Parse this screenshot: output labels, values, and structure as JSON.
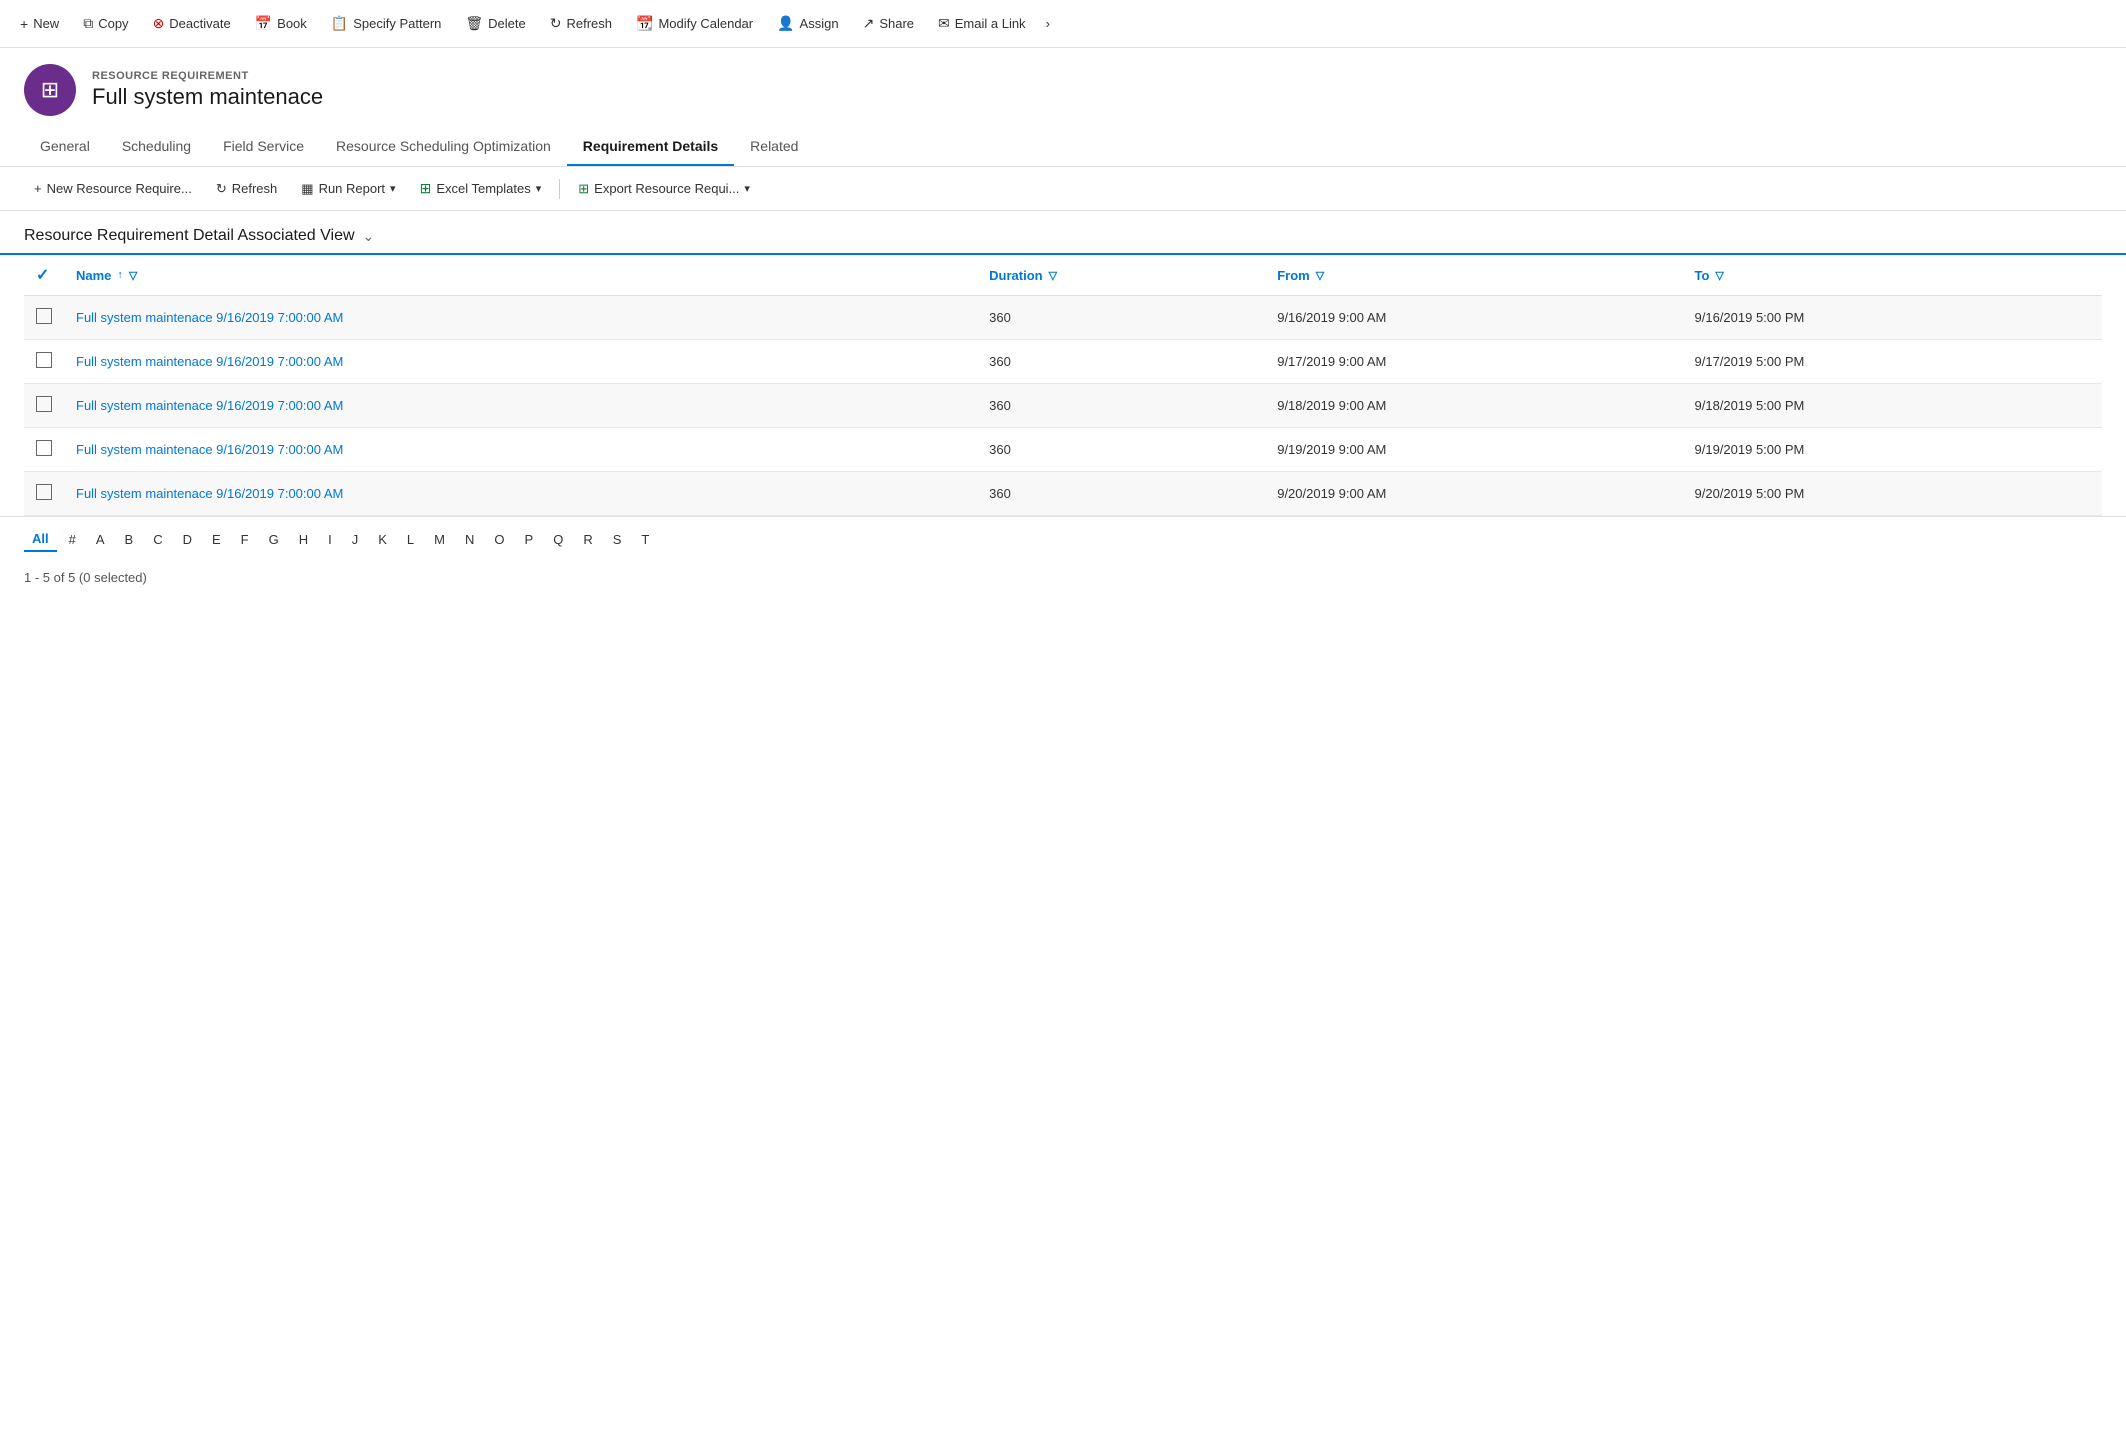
{
  "toolbar": {
    "buttons": [
      {
        "label": "New",
        "icon": "+",
        "name": "new-button"
      },
      {
        "label": "Copy",
        "icon": "⧉",
        "name": "copy-button"
      },
      {
        "label": "Deactivate",
        "icon": "⊗",
        "name": "deactivate-button"
      },
      {
        "label": "Book",
        "icon": "📅",
        "name": "book-button"
      },
      {
        "label": "Specify Pattern",
        "icon": "📋",
        "name": "specify-pattern-button"
      },
      {
        "label": "Delete",
        "icon": "🗑",
        "name": "delete-button"
      },
      {
        "label": "Refresh",
        "icon": "↻",
        "name": "refresh-button"
      },
      {
        "label": "Modify Calendar",
        "icon": "📆",
        "name": "modify-calendar-button"
      },
      {
        "label": "Assign",
        "icon": "👤",
        "name": "assign-button"
      },
      {
        "label": "Share",
        "icon": "↗",
        "name": "share-button"
      },
      {
        "label": "Email a Link",
        "icon": "✉",
        "name": "email-link-button"
      }
    ]
  },
  "record": {
    "type": "RESOURCE REQUIREMENT",
    "title": "Full system maintenace",
    "icon": "⊞"
  },
  "tabs": [
    {
      "label": "General",
      "active": false
    },
    {
      "label": "Scheduling",
      "active": false
    },
    {
      "label": "Field Service",
      "active": false
    },
    {
      "label": "Resource Scheduling Optimization",
      "active": false
    },
    {
      "label": "Requirement Details",
      "active": true
    },
    {
      "label": "Related",
      "active": false
    }
  ],
  "sub_toolbar": {
    "buttons": [
      {
        "label": "New Resource Require...",
        "icon": "+",
        "name": "new-resource-req-button"
      },
      {
        "label": "Refresh",
        "icon": "↻",
        "name": "sub-refresh-button"
      },
      {
        "label": "Run Report",
        "icon": "▦",
        "name": "run-report-button",
        "dropdown": true
      },
      {
        "label": "Excel Templates",
        "icon": "⊞",
        "name": "excel-templates-button",
        "dropdown": true
      },
      {
        "label": "Export Resource Requi...",
        "icon": "⊞",
        "name": "export-button",
        "dropdown": true
      }
    ]
  },
  "view": {
    "title": "Resource Requirement Detail Associated View"
  },
  "grid": {
    "columns": [
      {
        "label": "Name",
        "name": "name-col",
        "sortable": true,
        "filterable": true
      },
      {
        "label": "Duration",
        "name": "duration-col",
        "sortable": false,
        "filterable": true
      },
      {
        "label": "From",
        "name": "from-col",
        "sortable": false,
        "filterable": true
      },
      {
        "label": "To",
        "name": "to-col",
        "sortable": false,
        "filterable": true
      }
    ],
    "rows": [
      {
        "name": "Full system maintenace 9/16/2019 7:00:00 AM",
        "duration": "360",
        "from": "9/16/2019 9:00 AM",
        "to": "9/16/2019 5:00 PM"
      },
      {
        "name": "Full system maintenace 9/16/2019 7:00:00 AM",
        "duration": "360",
        "from": "9/17/2019 9:00 AM",
        "to": "9/17/2019 5:00 PM"
      },
      {
        "name": "Full system maintenace 9/16/2019 7:00:00 AM",
        "duration": "360",
        "from": "9/18/2019 9:00 AM",
        "to": "9/18/2019 5:00 PM"
      },
      {
        "name": "Full system maintenace 9/16/2019 7:00:00 AM",
        "duration": "360",
        "from": "9/19/2019 9:00 AM",
        "to": "9/19/2019 5:00 PM"
      },
      {
        "name": "Full system maintenace 9/16/2019 7:00:00 AM",
        "duration": "360",
        "from": "9/20/2019 9:00 AM",
        "to": "9/20/2019 5:00 PM"
      }
    ]
  },
  "alpha_nav": {
    "items": [
      "All",
      "#",
      "A",
      "B",
      "C",
      "D",
      "E",
      "F",
      "G",
      "H",
      "I",
      "J",
      "K",
      "L",
      "M",
      "N",
      "O",
      "P",
      "Q",
      "R",
      "S",
      "T"
    ],
    "active": "All"
  },
  "footer": {
    "text": "1 - 5 of 5 (0 selected)"
  }
}
